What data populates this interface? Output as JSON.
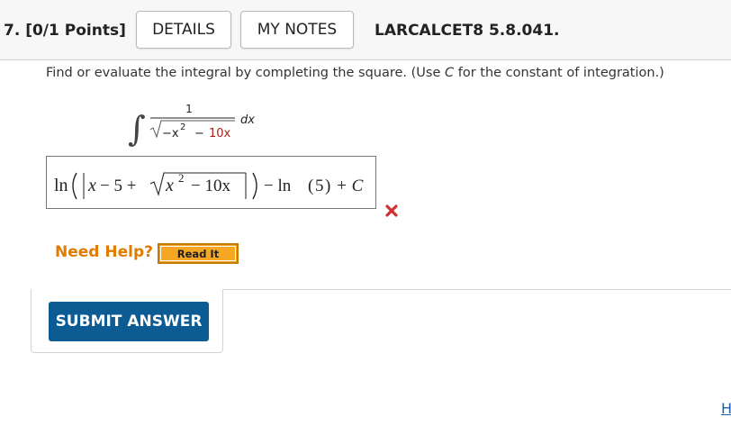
{
  "header": {
    "question_label": "7.  [0/1 Points]",
    "details_button": "DETAILS",
    "notes_button": "MY NOTES",
    "problem_ref": "LARCALCET8 5.8.041."
  },
  "question": {
    "text_before": "Find or evaluate the integral by completing the square. (Use ",
    "variable": "C",
    "text_after": " for the constant of integration.)"
  },
  "integral": {
    "numerator": "1",
    "radicand_a": "−x",
    "exponent": "2",
    "minus": "−",
    "radicand_b": "10x",
    "differential": "dx"
  },
  "answer": {
    "ln1": "ln",
    "x": "x",
    "minus_five": "− 5 +",
    "inner_x": "x",
    "inner_exp": "2",
    "inner_tail": "− 10x",
    "tail": "− ln",
    "ln_arg": "5",
    "plus_c": "+ C",
    "status": "incorrect"
  },
  "help": {
    "label": "Need Help?",
    "read_it": "Read It"
  },
  "submit_label": "SUBMIT ANSWER",
  "corner_link": "H",
  "colors": {
    "accent_blue": "#0c5b93",
    "help_orange": "#e07c00",
    "readit_bg": "#f5a623",
    "wrong_red": "#d03030",
    "radicand_red": "#a8201a"
  }
}
